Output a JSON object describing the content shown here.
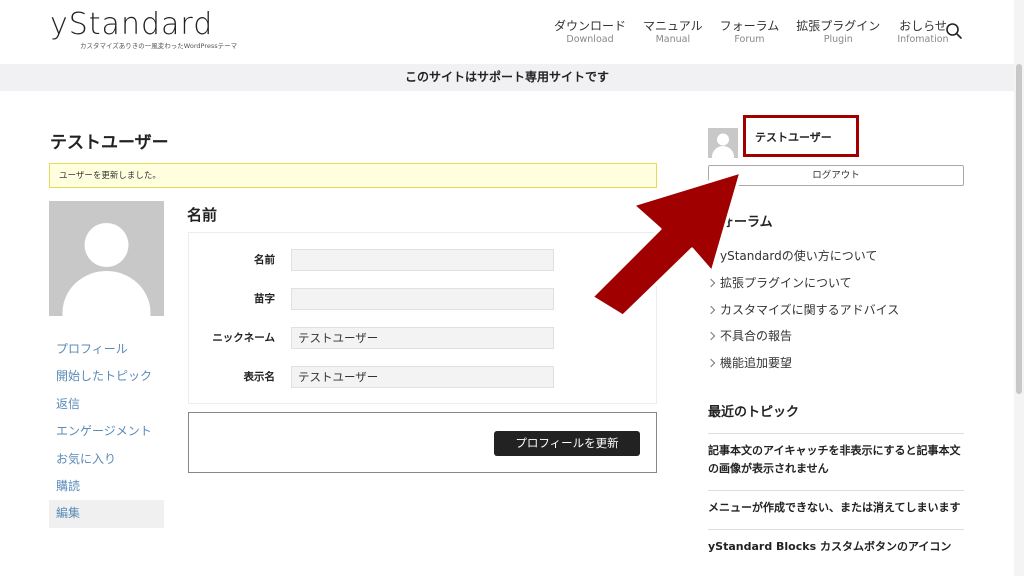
{
  "header": {
    "logo_text": "yStandard",
    "logo_tagline": "カスタマイズありきの一風変わったWordPressテーマ",
    "nav": [
      {
        "ja": "ダウンロード",
        "en": "Download"
      },
      {
        "ja": "マニュアル",
        "en": "Manual"
      },
      {
        "ja": "フォーラム",
        "en": "Forum"
      },
      {
        "ja": "拡張プラグイン",
        "en": "Plugin"
      },
      {
        "ja": "おしらせ",
        "en": "Infomation"
      }
    ],
    "search_icon": "search-icon"
  },
  "notice": "このサイトはサポート専用サイトです",
  "main": {
    "page_title": "テストユーザー",
    "alert": "ユーザーを更新しました。",
    "profile_nav": [
      {
        "label": "プロフィール"
      },
      {
        "label": "開始したトピック"
      },
      {
        "label": "返信"
      },
      {
        "label": "エンゲージメント"
      },
      {
        "label": "お気に入り"
      },
      {
        "label": "購読"
      },
      {
        "label": "編集"
      }
    ],
    "section_title": "名前",
    "fields": [
      {
        "label": "名前",
        "value": ""
      },
      {
        "label": "苗字",
        "value": ""
      },
      {
        "label": "ニックネーム",
        "value": "テストユーザー"
      },
      {
        "label": "表示名",
        "value": "テストユーザー"
      }
    ],
    "submit_label": "プロフィールを更新"
  },
  "sidebar": {
    "username": "テストユーザー",
    "logout_label": "ログアウト",
    "forum_heading": "フォーラム",
    "forum_items": [
      {
        "label": "yStandardの使い方について"
      },
      {
        "label": "拡張プラグインについて"
      },
      {
        "label": "カスタマイズに関するアドバイス"
      },
      {
        "label": "不具合の報告"
      },
      {
        "label": "機能追加要望"
      }
    ],
    "topics_heading": "最近のトピック",
    "topics": [
      {
        "title": "記事本文のアイキャッチを非表示にすると記事本文の画像が表示されません"
      },
      {
        "title": "メニューが作成できない、または消えてしまいます"
      },
      {
        "title": "yStandard Blocks カスタムボタンのアイコン"
      }
    ]
  },
  "colors": {
    "annotation": "#a00000",
    "link": "#5a8ab8",
    "button_bg": "#222222",
    "notice_bg": "#f1f1f3",
    "alert_bg": "#ffffe0"
  }
}
